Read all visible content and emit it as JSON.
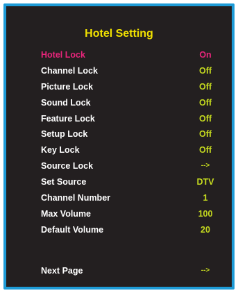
{
  "menu": {
    "title": "Hotel Setting",
    "items": [
      {
        "label": "Hotel Lock",
        "value": "On"
      },
      {
        "label": "Channel Lock",
        "value": "Off"
      },
      {
        "label": "Picture Lock",
        "value": "Off"
      },
      {
        "label": "Sound Lock",
        "value": "Off"
      },
      {
        "label": "Feature Lock",
        "value": "Off"
      },
      {
        "label": "Setup Lock",
        "value": "Off"
      },
      {
        "label": "Key Lock",
        "value": "Off"
      },
      {
        "label": "Source Lock",
        "value": "-->"
      },
      {
        "label": "Set Source",
        "value": "DTV"
      },
      {
        "label": "Channel Number",
        "value": "1"
      },
      {
        "label": "Max Volume",
        "value": "100"
      },
      {
        "label": "Default Volume",
        "value": "20"
      }
    ],
    "next_page": {
      "label": "Next Page",
      "value": "-->"
    },
    "selected_index": 0
  },
  "colors": {
    "background": "#231f20",
    "frame_border": "#1d9bd7",
    "title": "#f2e200",
    "label": "#ffffff",
    "value": "#c6db1f",
    "selected": "#e8257b"
  }
}
